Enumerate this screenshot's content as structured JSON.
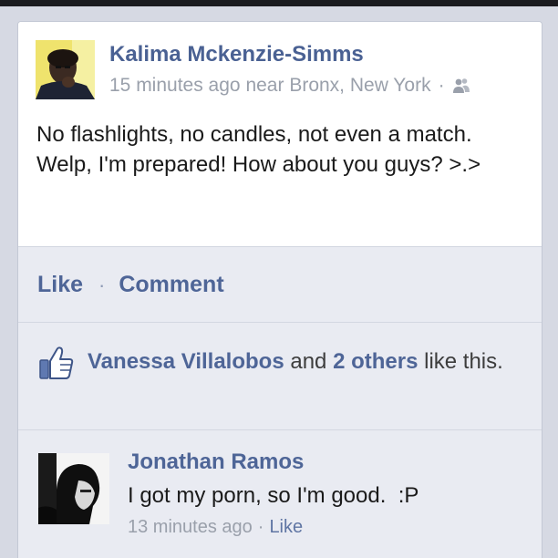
{
  "post": {
    "author": "Kalima Mckenzie-Simms",
    "time": "15 minutes ago",
    "location": "near Bronx, New York",
    "separator": "·",
    "privacy_icon": "friends-icon",
    "text": "No flashlights, no candles, not even a match. Welp, I'm prepared! How about you guys? >.>"
  },
  "actions": {
    "like_label": "Like",
    "separator": "·",
    "comment_label": "Comment"
  },
  "likes": {
    "icon": "thumbs-up-icon",
    "first_name": "Vanessa Villalobos",
    "connector": " and ",
    "others": "2 others",
    "suffix": " like this."
  },
  "comment": {
    "author": "Jonathan Ramos",
    "text": "I got my porn, so I'm good.  :P",
    "time": "13 minutes ago",
    "separator": "·",
    "like_label": "Like"
  },
  "colors": {
    "link_blue": "#4e6597",
    "meta_gray": "#9aa0ab",
    "panel_bg": "#e9ebf2",
    "page_bg": "#d6d9e3"
  }
}
